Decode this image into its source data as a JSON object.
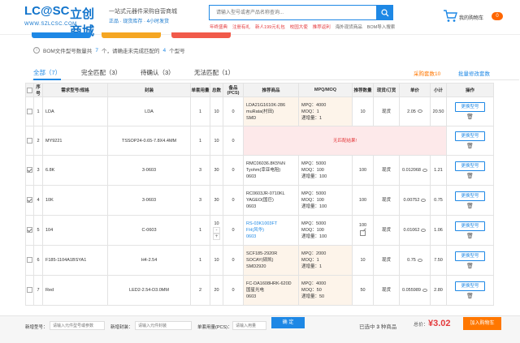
{
  "header": {
    "logo_main": "LC@SC",
    "logo_cn": "立创商城",
    "logo_url": "WWW.SZLCSC.COM",
    "slogan": "一站式元器件采购自营商城",
    "slogan_sub": "正品 · 现货库存 · 4小时发货",
    "search_placeholder": "请输入型号或者产品名称查询...",
    "quick_links": [
      "年终盛典",
      "注册有礼",
      "新人199元礼包",
      "校园大使",
      "推荐返利",
      "海外现货商品",
      "BOM导入搜索"
    ],
    "cart_label": "我的购物车",
    "cart_count": "0"
  },
  "colors": {
    "primary": "#1e88e5",
    "red": "#e4393c",
    "orange": "#ff7700",
    "yellow": "#f5a623",
    "coral": "#f15a4a"
  },
  "notice": {
    "prefix": "BOM文件型号数量共",
    "count": "7",
    "middle": "个，请确走未完成匹配的",
    "pending": "4",
    "suffix": "个型号"
  },
  "tabs": [
    {
      "label": "全部（7）"
    },
    {
      "label": "完全匹配（3）"
    },
    {
      "label": "待确认（3）"
    },
    {
      "label": "无法匹配（1）"
    }
  ],
  "tab_right": {
    "purchase": "采购套数10",
    "batch_edit": "批量修改套数"
  },
  "table": {
    "headers": [
      "序号",
      "需求型号/规格",
      "封装",
      "单套用量",
      "总数",
      "备品(PCS)",
      "推荐商品",
      "MPQ/MOQ",
      "推荐数量",
      "现货/订货",
      "单价",
      "小计",
      "操作"
    ],
    "rows": [
      {
        "no": "1",
        "spec": "LDA",
        "pkg": "LDA",
        "unit": "1",
        "total": "10",
        "spare": "0",
        "rec1": "LDA21G1610K-286",
        "rec2": "muRata(村田)",
        "rec3": "SMD",
        "mpq": "MPQ：4000",
        "moq": "MOQ：1",
        "inc": "递增量：1",
        "qty": "10",
        "stock": "现货",
        "price": "2.05",
        "subtotal": "20.50",
        "btn": "更换型号"
      },
      {
        "no": "2",
        "spec": "MY9221",
        "pkg": "TSSOP24-0.65-7.8X4.4MM",
        "unit": "1",
        "total": "10",
        "spare": "0",
        "nomatch": "无匹配结果!",
        "btn": "更换型号"
      },
      {
        "no": "3",
        "spec": "6.8K",
        "pkg": "3-0603",
        "unit": "3",
        "total": "30",
        "spare": "0",
        "rec1": "RMC06036.8K5%N",
        "rec2": "Tyohm(幸亚电阻)",
        "rec3": "0603",
        "mpq": "MPQ：5000",
        "moq": "MOQ：100",
        "inc": "递增量：100",
        "qty": "100",
        "stock": "现货",
        "price": "0.012068",
        "subtotal": "1.21",
        "btn": "更换型号"
      },
      {
        "no": "4",
        "spec": "10K",
        "pkg": "3-0603",
        "unit": "3",
        "total": "30",
        "spare": "0",
        "rec1": "RC0603JR-0710KL",
        "rec2": "YAGEO(国巨)",
        "rec3": "0603",
        "mpq": "MPQ：5000",
        "moq": "MOQ：100",
        "inc": "递增量：100",
        "qty": "100",
        "stock": "现货",
        "price": "0.00752",
        "subtotal": "0.75",
        "btn": "更换型号"
      },
      {
        "no": "5",
        "spec": "104",
        "pkg": "C-0603",
        "unit": "1",
        "total": "10",
        "spare": "0",
        "rec1": "RS-03K1003FT",
        "rec2": "FH(风华)",
        "rec3": "0603",
        "mpq": "MPQ：5000",
        "moq": "MOQ：100",
        "inc": "递增量：100",
        "qty": "100",
        "stock": "现货",
        "price": "0.01062",
        "subtotal": "1.06",
        "btn": "更换型号",
        "minus": "-",
        "plus": "+"
      },
      {
        "no": "6",
        "spec": "F185-1104A1BSYA1",
        "pkg": "H4-2.54",
        "unit": "1",
        "total": "10",
        "spare": "0",
        "rec1": "SCF185-2920R",
        "rec2": "SOCAY(硕凯)",
        "rec3": "SMD2920",
        "mpq": "MPQ：2000",
        "moq": "MOQ：1",
        "inc": "递增量：1",
        "qty": "10",
        "stock": "现货",
        "price": "0.75",
        "subtotal": "7.50",
        "btn": "更换型号"
      },
      {
        "no": "7",
        "spec": "Red",
        "pkg": "LED2-2.54-D3.0MM",
        "unit": "2",
        "total": "20",
        "spare": "0",
        "rec1": "FC-DA1608HRK-620D",
        "rec2": "国星光电",
        "rec3": "0603",
        "mpq": "MPQ：4000",
        "moq": "MOQ：50",
        "inc": "递增量：50",
        "qty": "50",
        "stock": "现货",
        "price": "0.055989",
        "subtotal": "2.80",
        "btn": "更换型号"
      }
    ]
  },
  "footer": {
    "new_model_label": "新增型号：",
    "new_model_ph": "请输入元件型号或参数",
    "new_pkg_label": "新增封装：",
    "new_pkg_ph": "请输入元件封装",
    "unit_label": "单套用量(PCS)：",
    "unit_ph": "请输入用量",
    "confirm": "确 定",
    "selected_prefix": "已选中",
    "selected_count": "3",
    "selected_suffix": "种商品",
    "total_label": "总价：",
    "total_value": "¥3.02",
    "add_cart": "加入购物车"
  }
}
